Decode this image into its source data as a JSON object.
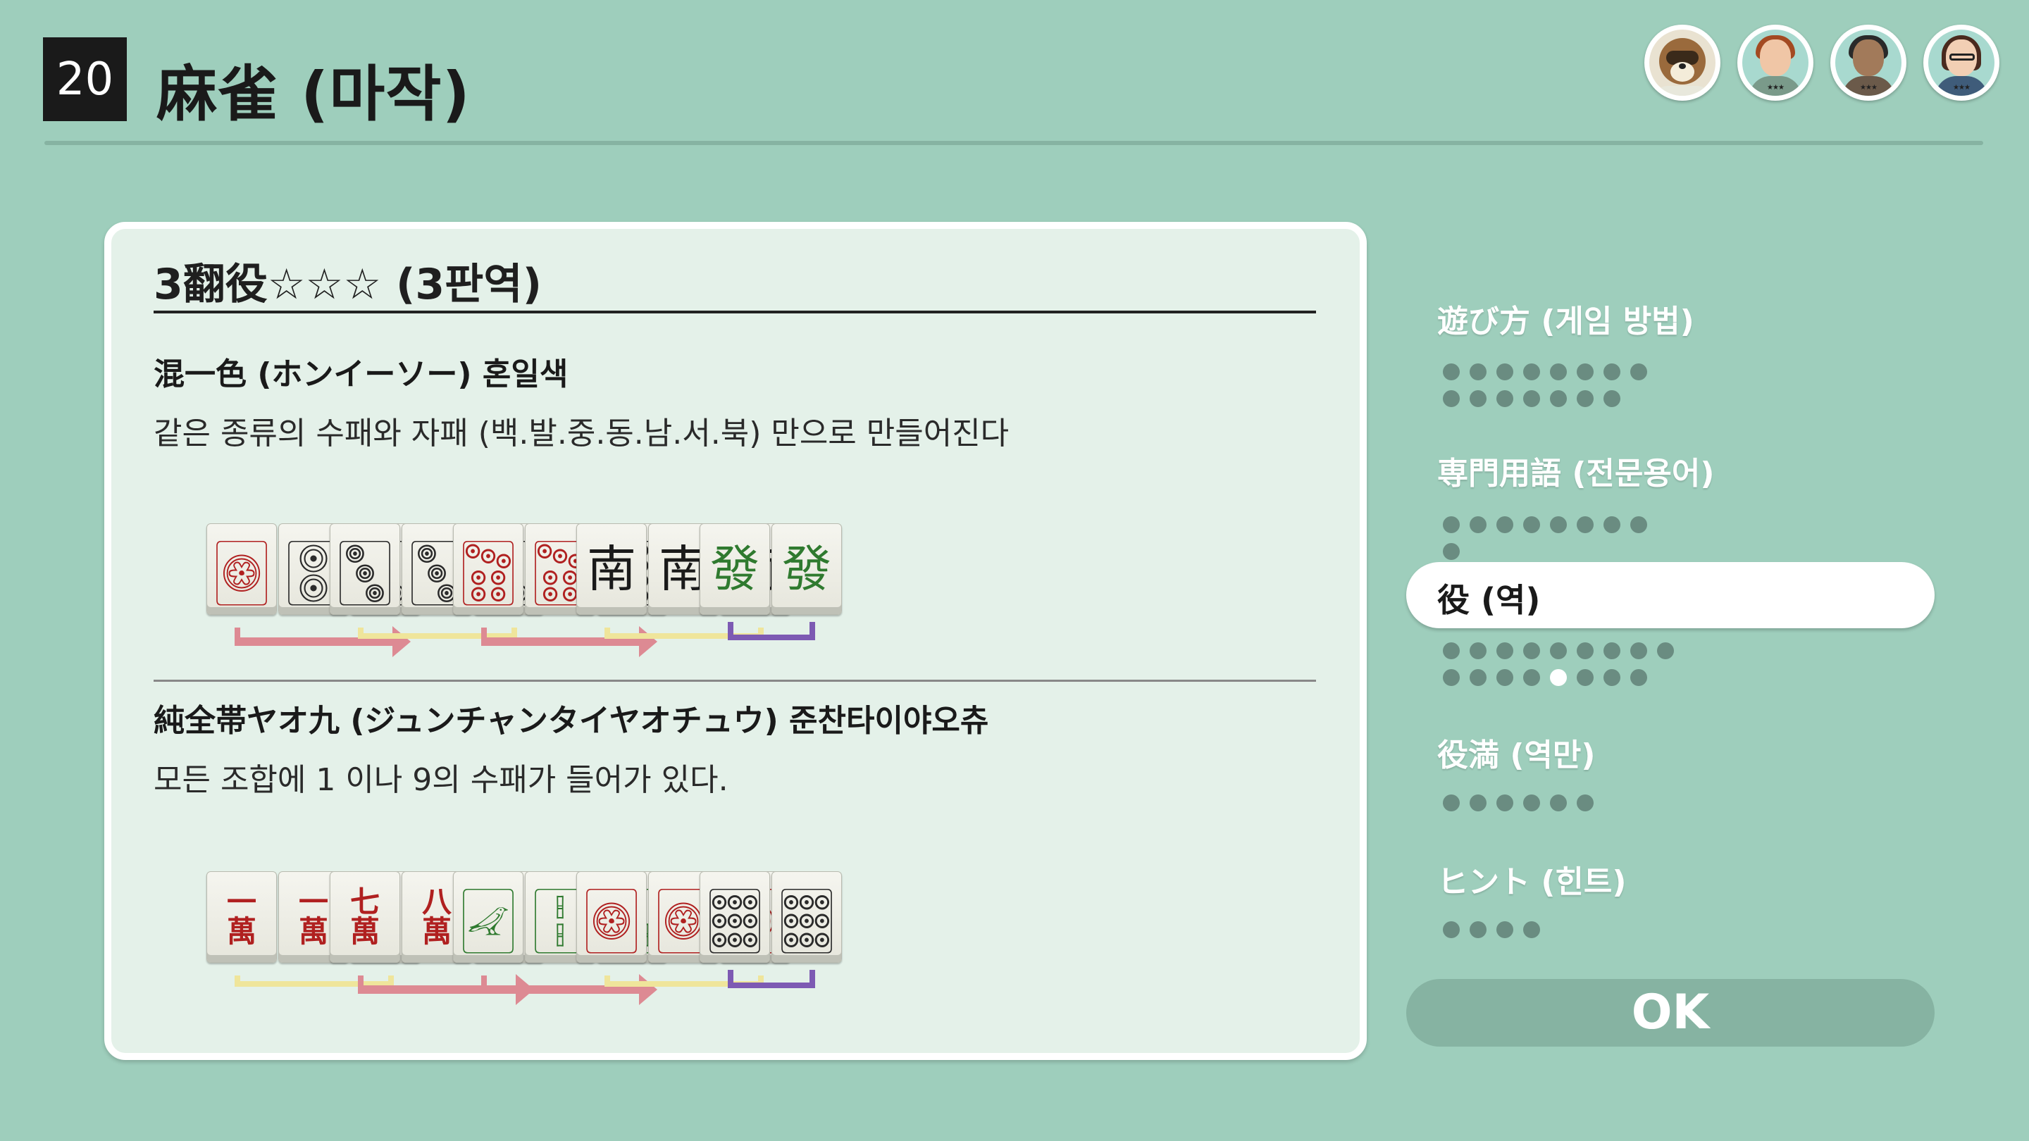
{
  "header": {
    "game_number": "20",
    "title": "麻雀 (마작)"
  },
  "players": [
    {
      "name": "tom-nook-avatar",
      "stars": ""
    },
    {
      "name": "player-avatar-2",
      "stars": "★★★"
    },
    {
      "name": "player-avatar-3",
      "stars": "★★★"
    },
    {
      "name": "player-avatar-4",
      "stars": "★★★"
    }
  ],
  "card": {
    "title": "3翻役☆☆☆ (3판역)",
    "sections": [
      {
        "name": "混一色 (ホンイーソー) 혼일색",
        "description": "같은 종류의 수패와 자패 (백.발.중.동.남.서.북) 만으로 만들어진다",
        "tiles": [
          {
            "glyph": "🀙",
            "color": "#b02020"
          },
          {
            "glyph": "🀚",
            "color": "#2a2a2a"
          },
          {
            "glyph": "🀛",
            "color": "#2a2a2a"
          },
          {
            "glyph": "🀛",
            "color": "#2a2a2a"
          },
          {
            "glyph": "🀛",
            "color": "#2a2a2a"
          },
          {
            "glyph": "🀛",
            "color": "#2a2a2a"
          },
          {
            "glyph": "🀟",
            "color": "#b02020"
          },
          {
            "glyph": "🀟",
            "color": "#b02020"
          },
          {
            "glyph": "🀠",
            "color": "#2a2a2a"
          },
          {
            "glyph": "南",
            "color": "#1a1a1a"
          },
          {
            "glyph": "南",
            "color": "#1a1a1a"
          },
          {
            "glyph": "南",
            "color": "#1a1a1a"
          },
          {
            "glyph": "發",
            "color": "#2f7a2f"
          },
          {
            "glyph": "發",
            "color": "#2f7a2f"
          }
        ]
      },
      {
        "name": "純全帯ヤオ九 (ジュンチャンタイヤオチュウ) 준찬타이야오츄",
        "description": "모든 조합에 1 이나 9의 수패가 들어가 있다.",
        "tiles": [
          {
            "glyph": "一\n萬",
            "color": "#b02020"
          },
          {
            "glyph": "一\n萬",
            "color": "#b02020"
          },
          {
            "glyph": "一\n萬",
            "color": "#b02020"
          },
          {
            "glyph": "七\n萬",
            "color": "#b02020"
          },
          {
            "glyph": "八\n萬",
            "color": "#b02020"
          },
          {
            "glyph": "九\n萬",
            "color": "#b02020"
          },
          {
            "glyph": "🀐",
            "color": "#2f7a2f"
          },
          {
            "glyph": "🀑",
            "color": "#2f7a2f"
          },
          {
            "glyph": "🀒",
            "color": "#2f7a2f"
          },
          {
            "glyph": "🀙",
            "color": "#b02020"
          },
          {
            "glyph": "🀙",
            "color": "#b02020"
          },
          {
            "glyph": "🀙",
            "color": "#b02020"
          },
          {
            "glyph": "🀡",
            "color": "#2a2a2a"
          },
          {
            "glyph": "🀡",
            "color": "#2a2a2a"
          }
        ]
      }
    ]
  },
  "menu": {
    "items": [
      {
        "label": "遊び方 (게임 방법)",
        "dot_count": 15,
        "active_dot": -1
      },
      {
        "label": "専門用語 (전문용어)",
        "dot_count": 9,
        "active_dot": -1
      },
      {
        "label": "役 (역)",
        "dot_count": 17,
        "active_dot": 13,
        "selected": true
      },
      {
        "label": "役満 (역만)",
        "dot_count": 6,
        "active_dot": -1
      },
      {
        "label": "ヒント (힌트)",
        "dot_count": 4,
        "active_dot": -1
      }
    ],
    "ok_label": "OK"
  },
  "colors": {
    "background": "#9ecebc",
    "run_arrow": "#dd8a93",
    "triplet_bracket": "#efe59b",
    "pair_bracket": "#7d5ab3"
  }
}
